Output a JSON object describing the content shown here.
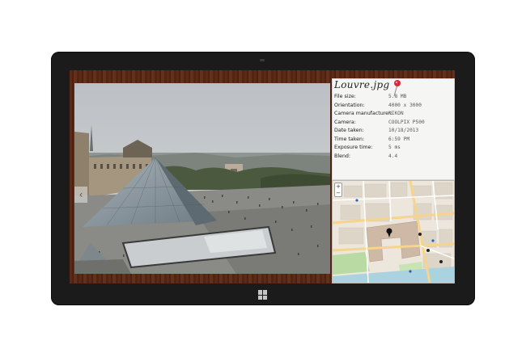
{
  "photo": {
    "alt": "Louvre Pyramid photo",
    "prev_arrow": "‹"
  },
  "info": {
    "title": "Louvre.jpg",
    "rows": [
      {
        "label": "File size:",
        "value": "5.8 MB"
      },
      {
        "label": "Orientation:",
        "value": "4000 x 3000"
      },
      {
        "label": "Camera manufacturer:",
        "value": "NIKON"
      },
      {
        "label": "Camera:",
        "value": "COOLPIX P500"
      },
      {
        "label": "Date taken:",
        "value": "10/18/2013"
      },
      {
        "label": "Time taken:",
        "value": "6:59 PM"
      },
      {
        "label": "Exposure time:",
        "value": "5 ms"
      },
      {
        "label": "Blend:",
        "value": "4.4"
      }
    ]
  },
  "map": {
    "zoom_in": "+",
    "zoom_out": "−"
  },
  "colors": {
    "bezel": "#1b1b1b",
    "wood_background": "#5c2a17",
    "pin": "#e0263a",
    "map_road": "#f6d48b",
    "map_park": "#b9dba3"
  }
}
